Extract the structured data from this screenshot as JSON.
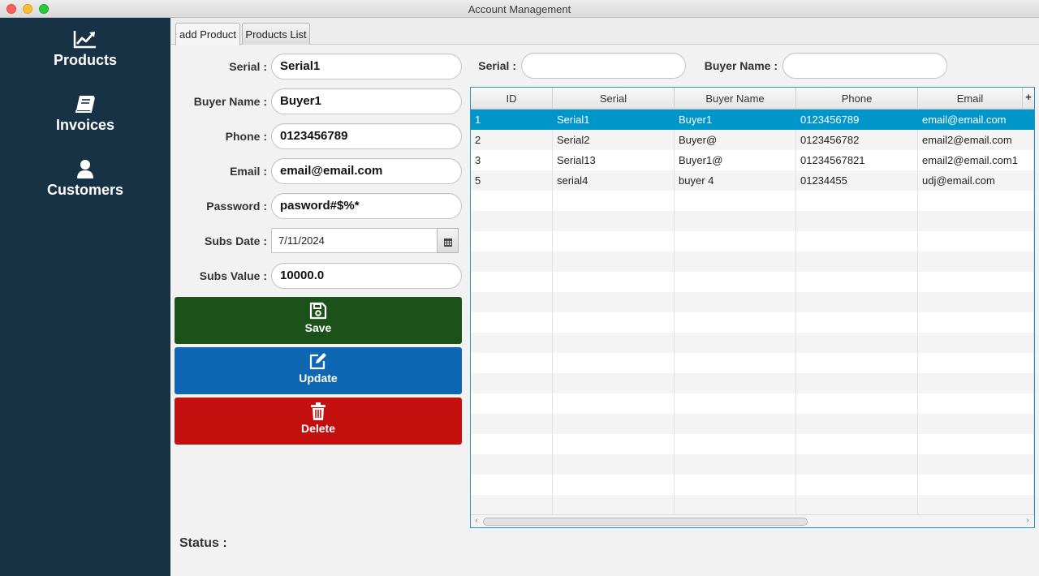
{
  "window": {
    "title": "Account Management"
  },
  "sidebar": {
    "items": [
      {
        "label": "Products",
        "icon": "chart-line-icon"
      },
      {
        "label": "Invoices",
        "icon": "book-icon"
      },
      {
        "label": "Customers",
        "icon": "user-icon"
      }
    ]
  },
  "tabs": [
    {
      "label": "add Product",
      "active": true
    },
    {
      "label": "Products List",
      "active": false
    }
  ],
  "form": {
    "serial_label": "Serial :",
    "serial_value": "Serial1",
    "buyer_label": "Buyer Name :",
    "buyer_value": "Buyer1",
    "phone_label": "Phone :",
    "phone_value": "0123456789",
    "email_label": "Email :",
    "email_value": "email@email.com",
    "password_label": "Password :",
    "password_value": "pasword#$%*",
    "subs_date_label": "Subs Date :",
    "subs_date_value": "7/11/2024",
    "subs_value_label": "Subs Value :",
    "subs_value_value": "10000.0"
  },
  "actions": {
    "save": {
      "label": "Save",
      "color": "#1b521a"
    },
    "update": {
      "label": "Update",
      "color": "#0f66b2"
    },
    "delete": {
      "label": "Delete",
      "color": "#c40f0f"
    }
  },
  "search": {
    "serial_label": "Serial :",
    "serial_value": "",
    "buyer_label": "Buyer Name :",
    "buyer_value": ""
  },
  "table": {
    "columns": [
      "ID",
      "Serial",
      "Buyer Name",
      "Phone",
      "Email"
    ],
    "rows": [
      {
        "id": "1",
        "serial": "Serial1",
        "buyer": "Buyer1",
        "phone": "0123456789",
        "email": "email@email.com",
        "selected": true
      },
      {
        "id": "2",
        "serial": "Serial2",
        "buyer": "Buyer@",
        "phone": "0123456782",
        "email": "email2@email.com",
        "selected": false
      },
      {
        "id": "3",
        "serial": "Serial13",
        "buyer": "Buyer1@",
        "phone": "01234567821",
        "email": "email2@email.com1",
        "selected": false
      },
      {
        "id": "5",
        "serial": "serial4",
        "buyer": "buyer 4",
        "phone": "01234455",
        "email": "udj@email.com",
        "selected": false
      }
    ],
    "selection_color": "#0096c9"
  },
  "status": {
    "label": "Status :"
  }
}
